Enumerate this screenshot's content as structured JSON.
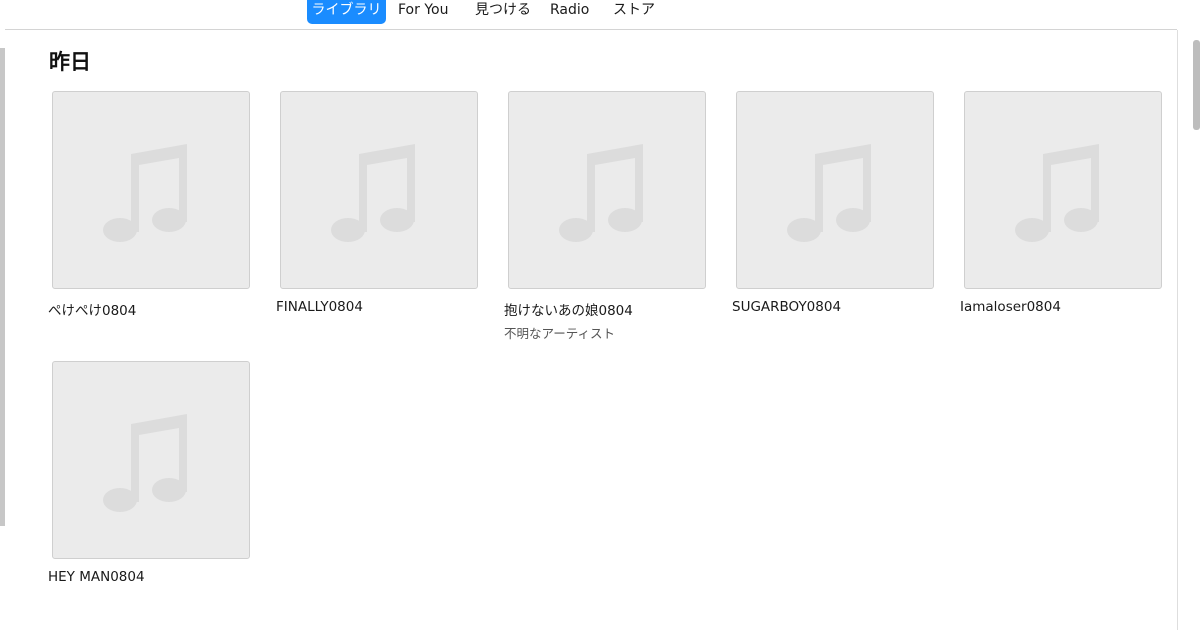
{
  "nav": {
    "tabs": [
      {
        "label": "ライブラリ",
        "active": true
      },
      {
        "label": "For You",
        "active": false
      },
      {
        "label": "見つける",
        "active": false
      },
      {
        "label": "Radio",
        "active": false
      },
      {
        "label": "ストア",
        "active": false
      }
    ]
  },
  "section": {
    "title": "昨日"
  },
  "albums": [
    {
      "title": "ぺけぺけ0804",
      "artist": ""
    },
    {
      "title": "FINALLY0804",
      "artist": ""
    },
    {
      "title": "抱けないあの娘0804",
      "artist": "不明なアーティスト"
    },
    {
      "title": "SUGARBOY0804",
      "artist": ""
    },
    {
      "title": "Iamaloser0804",
      "artist": ""
    },
    {
      "title": "HEY MAN0804",
      "artist": ""
    }
  ],
  "colors": {
    "accent": "#1a8cff",
    "artwork_bg": "#ebebeb",
    "note_glyph": "#dcdcdc"
  },
  "icons": {
    "artwork_placeholder": "music-note-icon"
  }
}
